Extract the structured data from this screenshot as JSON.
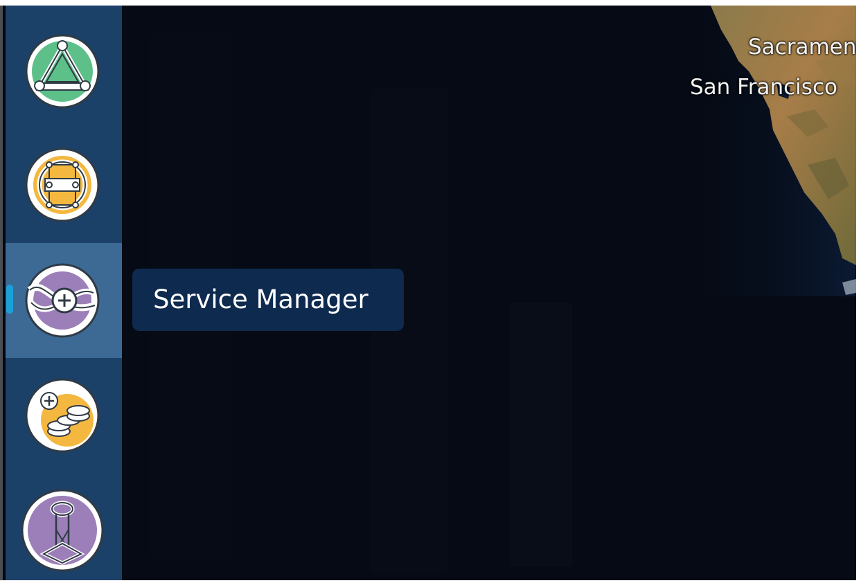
{
  "map": {
    "cities": [
      {
        "name": "Sacramento"
      },
      {
        "name": "San Francisco"
      }
    ]
  },
  "sidebar": {
    "items": [
      {
        "name": "topology-app",
        "icon": "triangle-network-icon",
        "color": "#5ec089",
        "active": false
      },
      {
        "name": "grid-app",
        "icon": "node-grid-icon",
        "color": "#f4b73f",
        "active": false
      },
      {
        "name": "service-manager-app",
        "icon": "service-plus-icon",
        "color": "#9c7fb8",
        "active": true
      },
      {
        "name": "stack-add-app",
        "icon": "disk-stack-plus-icon",
        "color": "#f4b73f",
        "active": false
      },
      {
        "name": "tower-app",
        "icon": "antenna-tower-icon",
        "color": "#9c7fb8",
        "active": false
      }
    ]
  },
  "tooltip": {
    "label": "Service Manager"
  },
  "colors": {
    "sidebar_bg": "#1c4169",
    "active_bg": "#3c6a95",
    "indicator": "#1aa1d8",
    "tooltip_bg": "#0e2a4f"
  }
}
